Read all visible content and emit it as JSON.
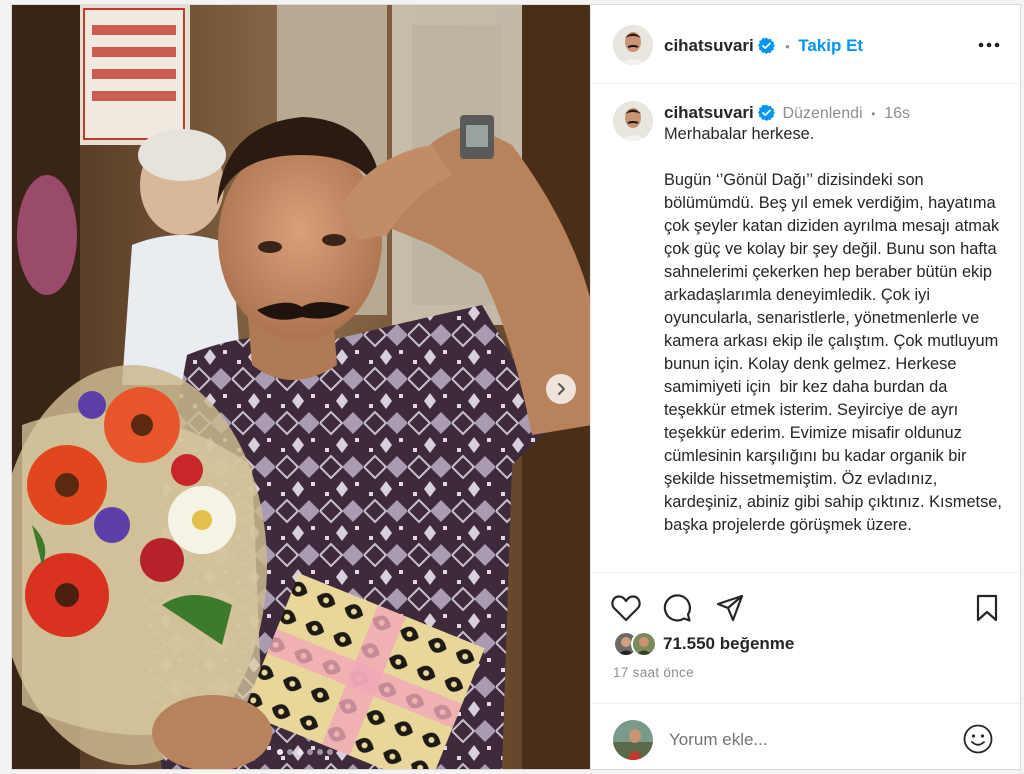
{
  "post": {
    "author": {
      "username": "cihatsuvari",
      "verified": true
    },
    "follow_label": "Takip Et",
    "header_separator": "•",
    "more_icon": "more-horizontal-icon",
    "media": {
      "carousel_next_icon": "chevron-right-icon",
      "slide_count": 6,
      "active_slide": 1
    },
    "caption": {
      "username": "cihatsuvari",
      "edited_label": "Düzenlendi",
      "separator": "•",
      "age": "16s",
      "text": "Merhabalar herkese.\n\nBugün ‘’Gönül Dağı’’ dizisindeki son bölümümdü. Beş yıl emek verdiğim, hayatıma çok şeyler katan diziden ayrılma mesajı atmak çok güç ve kolay bir şey değil. Bunu son hafta sahnelerimi çekerken hep beraber bütün ekip arkadaşlarımla deneyimledik. Çok iyi oyuncularla, senaristlerle, yönetmenlerle ve kamera arkası ekip ile çalıştım. Çok mutluyum bunun için. Kolay denk gelmez. Herkese samimiyeti için  bir kez daha burdan da teşekkür etmek isterim. Seyirciye de ayrı teşekkür ederim. Evimize misafir oldunuz cümlesinin karşılığını bu kadar organik bir şekilde hissetmemiştim. Öz evladınız, kardeşiniz, abiniz gibi sahip çıktınız. Kısmetse, başka projelerde görüşmek üzere."
    },
    "actions": {
      "like_icon": "heart-icon",
      "comment_icon": "comment-icon",
      "share_icon": "send-icon",
      "save_icon": "bookmark-icon"
    },
    "likes_count": "71.550",
    "likes_label": "beğenme",
    "time_ago": "17 saat önce",
    "comment": {
      "placeholder": "Yorum ekle...",
      "emoji_icon": "smiley-icon"
    }
  },
  "colors": {
    "accent": "#0095f6",
    "text": "#262626",
    "muted": "#8e8e8e",
    "border": "#efefef"
  }
}
